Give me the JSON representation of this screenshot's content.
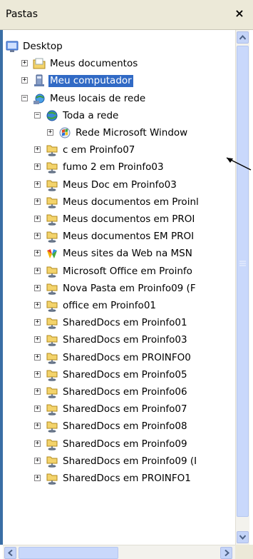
{
  "panel": {
    "title": "Pastas",
    "close_label": "×"
  },
  "tree": [
    {
      "label": "Desktop",
      "level": 0,
      "expander": "",
      "icon": "desktop-icon"
    },
    {
      "label": "Meus documentos",
      "level": 1,
      "expander": "+",
      "icon": "folder-icon"
    },
    {
      "label": "Meu computador",
      "level": 1,
      "expander": "+",
      "icon": "computer-icon",
      "selected": true
    },
    {
      "label": "Meus locais de rede",
      "level": 1,
      "expander": "−",
      "icon": "network-places-icon"
    },
    {
      "label": "Toda a rede",
      "level": 2,
      "expander": "−",
      "icon": "globe-icon"
    },
    {
      "label": "Rede Microsoft Window",
      "level": 3,
      "expander": "+",
      "icon": "windows-network-icon"
    },
    {
      "label": "c em Proinfo07",
      "level": 2,
      "expander": "+",
      "icon": "network-share-icon"
    },
    {
      "label": "fumo 2 em Proinfo03",
      "level": 2,
      "expander": "+",
      "icon": "network-share-icon"
    },
    {
      "label": "Meus Doc em Proinfo03",
      "level": 2,
      "expander": "+",
      "icon": "network-share-icon"
    },
    {
      "label": "Meus documentos em Proinl",
      "level": 2,
      "expander": "+",
      "icon": "network-share-icon"
    },
    {
      "label": "Meus documentos em PROI",
      "level": 2,
      "expander": "+",
      "icon": "network-share-icon"
    },
    {
      "label": "Meus documentos EM PROI",
      "level": 2,
      "expander": "+",
      "icon": "network-share-icon"
    },
    {
      "label": "Meus sites da Web na MSN",
      "level": 2,
      "expander": "+",
      "icon": "msn-sites-icon"
    },
    {
      "label": "Microsoft Office em Proinfo",
      "level": 2,
      "expander": "+",
      "icon": "network-share-icon"
    },
    {
      "label": "Nova Pasta em Proinfo09 (F",
      "level": 2,
      "expander": "+",
      "icon": "network-share-icon"
    },
    {
      "label": "office em Proinfo01",
      "level": 2,
      "expander": "+",
      "icon": "network-share-icon"
    },
    {
      "label": "SharedDocs em Proinfo01",
      "level": 2,
      "expander": "+",
      "icon": "network-share-icon"
    },
    {
      "label": "SharedDocs em Proinfo03",
      "level": 2,
      "expander": "+",
      "icon": "network-share-icon"
    },
    {
      "label": "SharedDocs em PROINFO0",
      "level": 2,
      "expander": "+",
      "icon": "network-share-icon"
    },
    {
      "label": "SharedDocs em Proinfo05",
      "level": 2,
      "expander": "+",
      "icon": "network-share-icon"
    },
    {
      "label": "SharedDocs em Proinfo06",
      "level": 2,
      "expander": "+",
      "icon": "network-share-icon"
    },
    {
      "label": "SharedDocs em Proinfo07",
      "level": 2,
      "expander": "+",
      "icon": "network-share-icon"
    },
    {
      "label": "SharedDocs em Proinfo08",
      "level": 2,
      "expander": "+",
      "icon": "network-share-icon"
    },
    {
      "label": "SharedDocs em Proinfo09",
      "level": 2,
      "expander": "+",
      "icon": "network-share-icon"
    },
    {
      "label": "SharedDocs em Proinfo09 (I",
      "level": 2,
      "expander": "+",
      "icon": "network-share-icon"
    },
    {
      "label": "SharedDocs em PROINFO1",
      "level": 2,
      "expander": "+",
      "icon": "network-share-icon"
    }
  ],
  "colors": {
    "selection": "#316AC5",
    "header_bg": "#ECE9D8",
    "scrollbar": "#C4D4F8"
  }
}
